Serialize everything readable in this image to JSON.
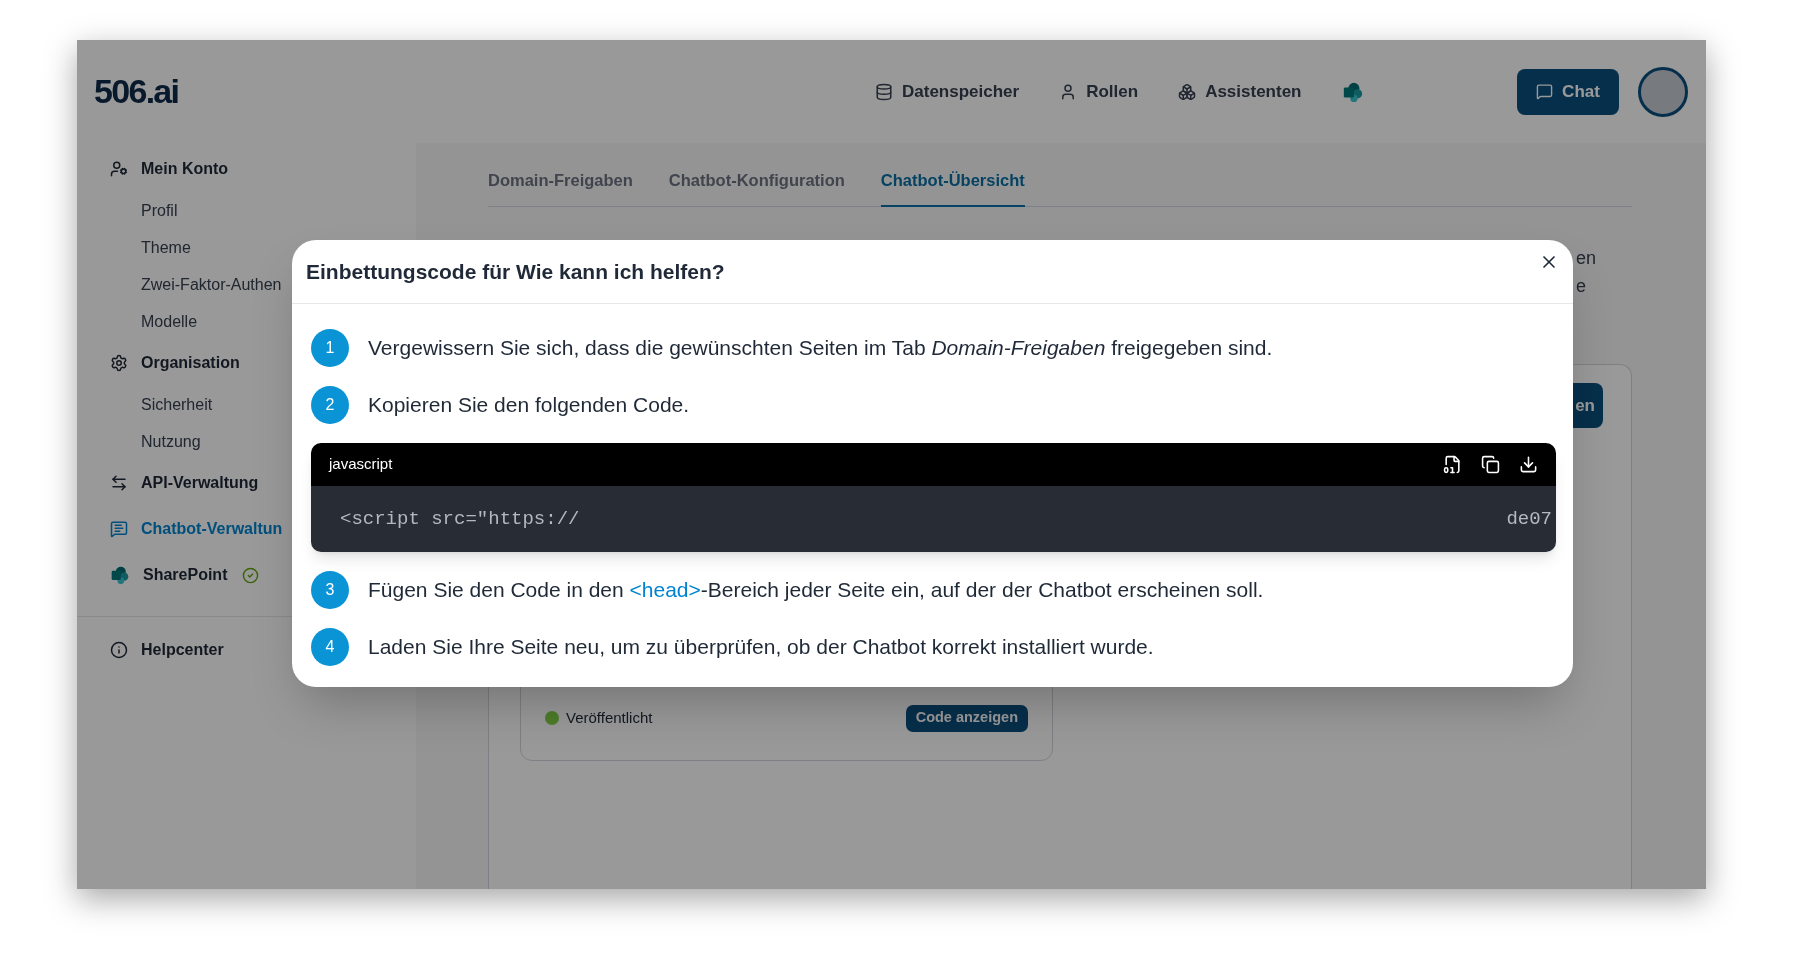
{
  "header": {
    "logo": "506.ai",
    "nav": [
      {
        "label": "Datenspeicher",
        "kind": "database"
      },
      {
        "label": "Rollen",
        "kind": "user"
      },
      {
        "label": "Assistenten",
        "kind": "assistants"
      },
      {
        "kind": "sharepoint"
      }
    ],
    "chat_button": "Chat"
  },
  "sidebar": {
    "sections": [
      {
        "label": "Mein Konto",
        "kind": "account",
        "selected": false,
        "children": [
          {
            "label": "Profil",
            "selected": false
          },
          {
            "label": "Theme",
            "selected": false
          },
          {
            "label": "Zwei-Faktor-Authen",
            "selected": false
          },
          {
            "label": "Modelle",
            "selected": false
          }
        ]
      },
      {
        "label": "Organisation",
        "kind": "settings",
        "selected": false,
        "children": [
          {
            "label": "Sicherheit",
            "selected": false
          },
          {
            "label": "Nutzung",
            "selected": false
          }
        ]
      },
      {
        "label": "API-Verwaltung",
        "kind": "api",
        "selected": false
      },
      {
        "label": "Chatbot-Verwaltun",
        "kind": "chatbot",
        "selected": true
      },
      {
        "label": "SharePoint",
        "kind": "sharepoint",
        "selected": false,
        "verified": true
      }
    ],
    "footer": [
      {
        "label": "Helpcenter",
        "kind": "help",
        "selected": false
      }
    ]
  },
  "tabs": [
    {
      "label": "Domain-Freigaben",
      "selected": false
    },
    {
      "label": "Chatbot-Konfiguration",
      "selected": false
    },
    {
      "label": "Chatbot-Übersicht",
      "selected": true
    }
  ],
  "main": {
    "partial_lines": [
      "en",
      "e"
    ],
    "panel_button": "en",
    "card": {
      "status": "Veröffentlicht",
      "color": "#4d7c2a",
      "button": "Code anzeigen"
    }
  },
  "dialog": {
    "title": "Einbettungscode für Wie kann ich helfen?",
    "blocks": [
      {
        "kind": "step",
        "number": "1",
        "parts": [
          {
            "kind": "plain",
            "text": "Vergewissern Sie sich, dass die gewünschten Seiten im Tab "
          },
          {
            "kind": "italic",
            "text": "Domain-Freigaben"
          },
          {
            "kind": "plain",
            "text": " freigegeben sind."
          }
        ]
      },
      {
        "kind": "step",
        "number": "2",
        "parts": [
          {
            "kind": "plain",
            "text": "Kopieren Sie den folgenden Code."
          }
        ]
      },
      {
        "kind": "code",
        "language": "javascript",
        "code_start": "<script src=\"https://",
        "code_end": "de07"
      },
      {
        "kind": "step",
        "number": "3",
        "parts": [
          {
            "kind": "plain",
            "text": "Fügen Sie den Code in den "
          },
          {
            "kind": "code",
            "text": "<head>"
          },
          {
            "kind": "plain",
            "text": "-Bereich jeder Seite ein, auf der der Chatbot erscheinen soll."
          }
        ]
      },
      {
        "kind": "step",
        "number": "4",
        "parts": [
          {
            "kind": "plain",
            "text": "Laden Sie Ihre Seite neu, um zu überprüfen, ob der Chatbot korrekt installiert wurde."
          }
        ]
      }
    ]
  }
}
